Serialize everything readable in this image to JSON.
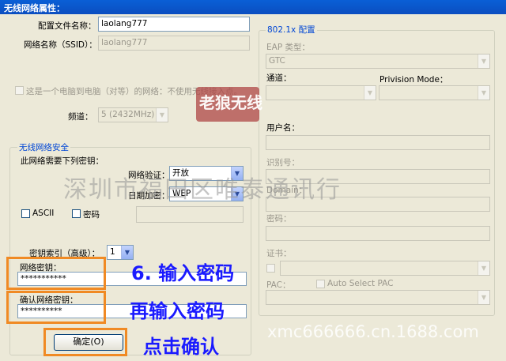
{
  "window": {
    "title": "无线网络属性："
  },
  "profile": {
    "config_name_label": "配置文件名称：",
    "config_name_value": "laolang777",
    "ssid_label": "网络名称（SSID）：",
    "ssid_value": "laolang777",
    "adhoc_label": "这是一个电脑到电脑（对等）的网络：不使用无线接入点。",
    "channel_label": "频道：",
    "channel_value": "5 (2432MHz)"
  },
  "security": {
    "group_title": "无线网络安全",
    "need_key_label": "此网络需要下列密钥：",
    "auth_label": "网络验证：",
    "auth_value": "开放",
    "encrypt_label": "日期加密：",
    "encrypt_value": "WEP",
    "ascii_label": "ASCII",
    "password_label": "密码",
    "key_index_label": "密钥索引（高级）：",
    "key_index_value": "1",
    "network_key_label": "网络密钥：",
    "network_key_value": "***********",
    "confirm_key_label": "确认网络密钥：",
    "confirm_key_value": "**********"
  },
  "eap": {
    "group_title": "802.1x 配置",
    "eap_type_label": "EAP 类型：",
    "eap_type_value": "GTC",
    "tunnel_label": "通道：",
    "provision_label": "Privision Mode：",
    "username_label": "用户名：",
    "identity_label": "识别号：",
    "domain_label": "Domain：",
    "password_label": "密码：",
    "cert_label": "证书：",
    "pac_label": "PAC：",
    "auto_pac_label": "Auto Select PAC"
  },
  "buttons": {
    "ok_label": "确定(O)"
  },
  "annotations": {
    "step6": "6. 输入密码",
    "reenter": "再输入密码",
    "click_ok": "点击确认"
  },
  "watermarks": {
    "company": "深圳市福田区唯泰通讯行",
    "site": "xmc666666.cn.1688.com",
    "logo": "老狼无线"
  },
  "colors": {
    "title_bar": "#0b4ec0",
    "highlight": "#f08a24",
    "annotation": "#1a1aff",
    "group_title": "#0046d5"
  }
}
